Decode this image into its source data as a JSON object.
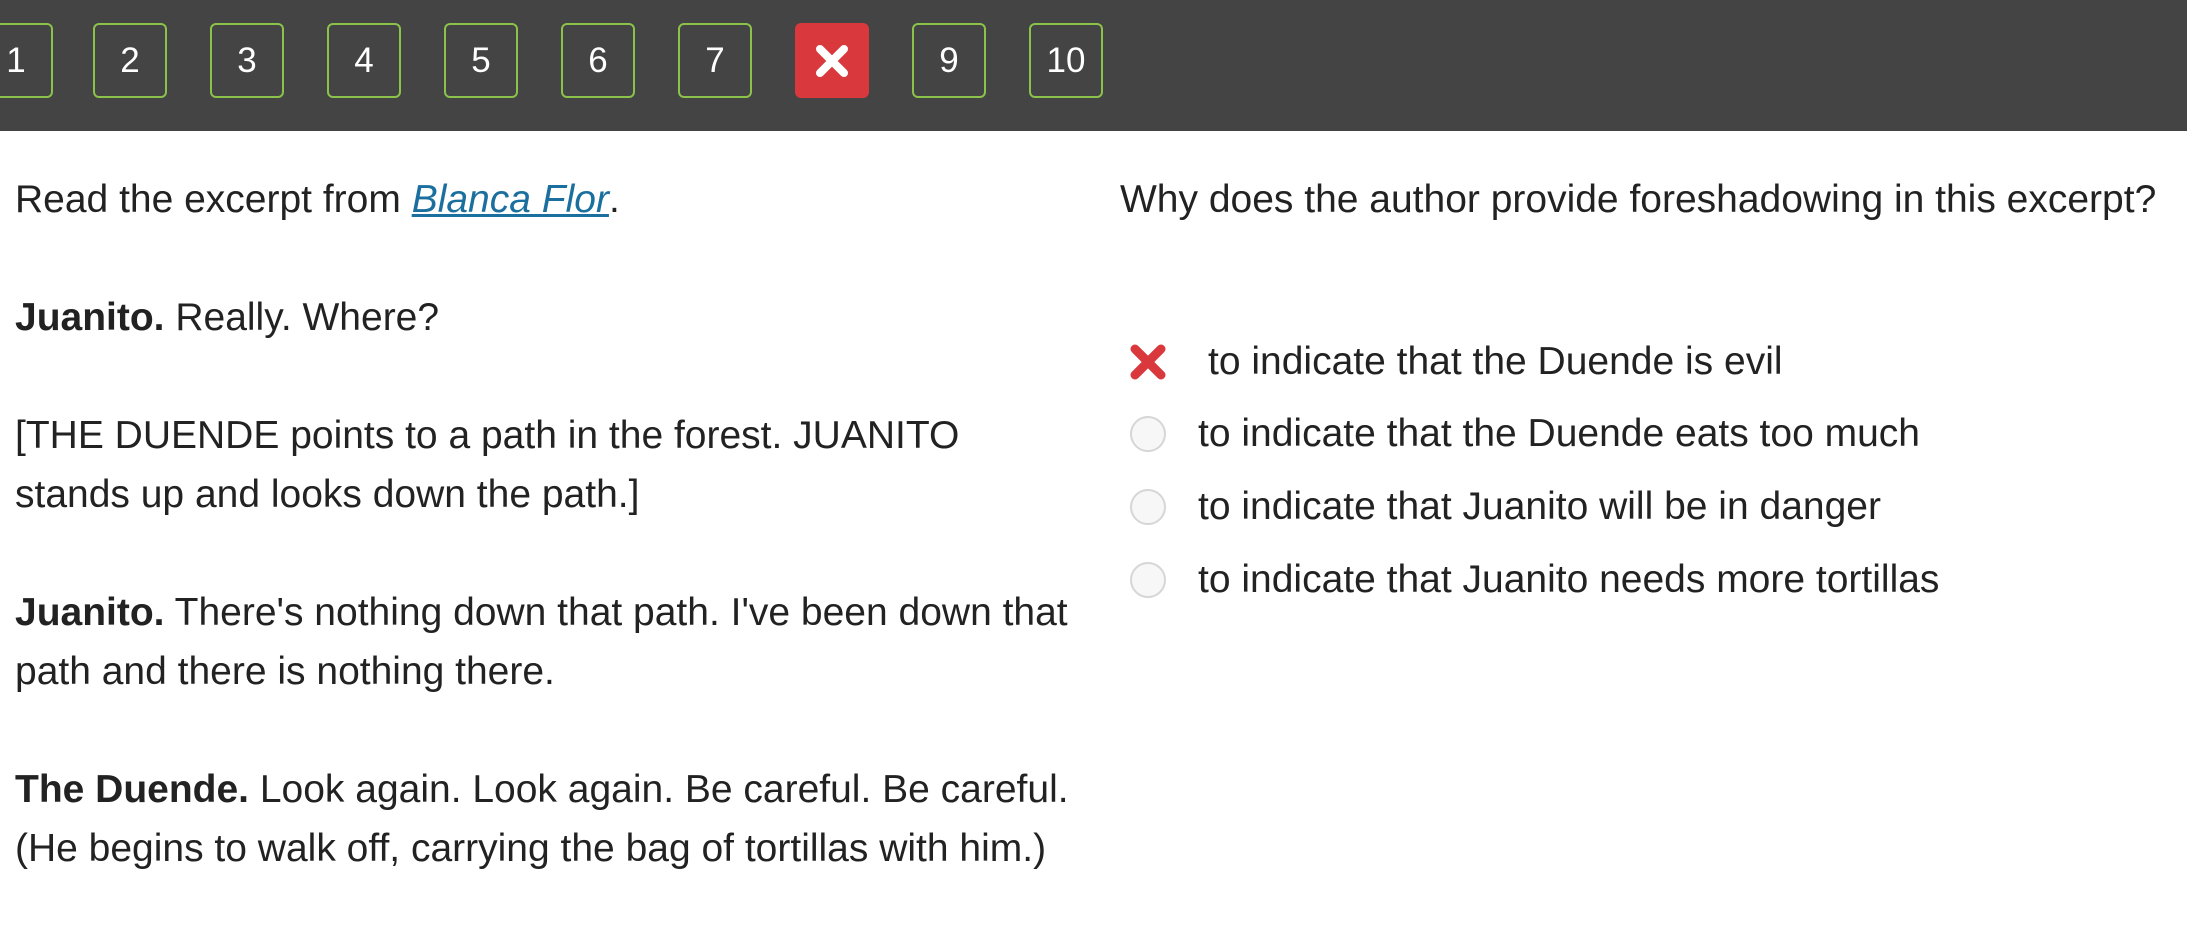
{
  "nav": {
    "buttons": [
      {
        "label": "1",
        "status": "normal"
      },
      {
        "label": "2",
        "status": "normal"
      },
      {
        "label": "3",
        "status": "normal"
      },
      {
        "label": "4",
        "status": "normal"
      },
      {
        "label": "5",
        "status": "normal"
      },
      {
        "label": "6",
        "status": "normal"
      },
      {
        "label": "7",
        "status": "normal"
      },
      {
        "label": "",
        "status": "incorrect",
        "icon": "x-icon"
      },
      {
        "label": "9",
        "status": "normal"
      },
      {
        "label": "10",
        "status": "normal"
      }
    ],
    "colors": {
      "bar": "#444444",
      "border": "#8bc34a",
      "incorrect": "#d9393c"
    }
  },
  "passage": {
    "intro_prefix": "Read the excerpt from ",
    "intro_link": "Blanca Flor",
    "intro_suffix": ".",
    "lines": [
      {
        "speaker": "Juanito.",
        "text": " Really. Where?"
      },
      {
        "speaker": "",
        "text": "[THE DUENDE points to a path in the forest. JUANITO stands up and looks down the path.]"
      },
      {
        "speaker": "Juanito.",
        "text": " There's nothing down that path. I've been down that path and there is nothing there."
      },
      {
        "speaker": "The Duende.",
        "text": " Look again. Look again. Be careful. Be careful. (He begins to walk off, carrying the bag of tortillas with him.)"
      }
    ]
  },
  "question": {
    "prompt": "Why does the author provide foreshadowing in this excerpt?",
    "options": [
      {
        "text": "to indicate that the Duende is evil",
        "state": "selected-incorrect"
      },
      {
        "text": "to indicate that the Duende eats too much",
        "state": "unselected"
      },
      {
        "text": "to indicate that Juanito will be in danger",
        "state": "unselected"
      },
      {
        "text": "to indicate that Juanito needs more tortillas",
        "state": "unselected"
      }
    ],
    "colors": {
      "wrong_mark": "#d9393c",
      "link": "#1b6f9f"
    }
  }
}
